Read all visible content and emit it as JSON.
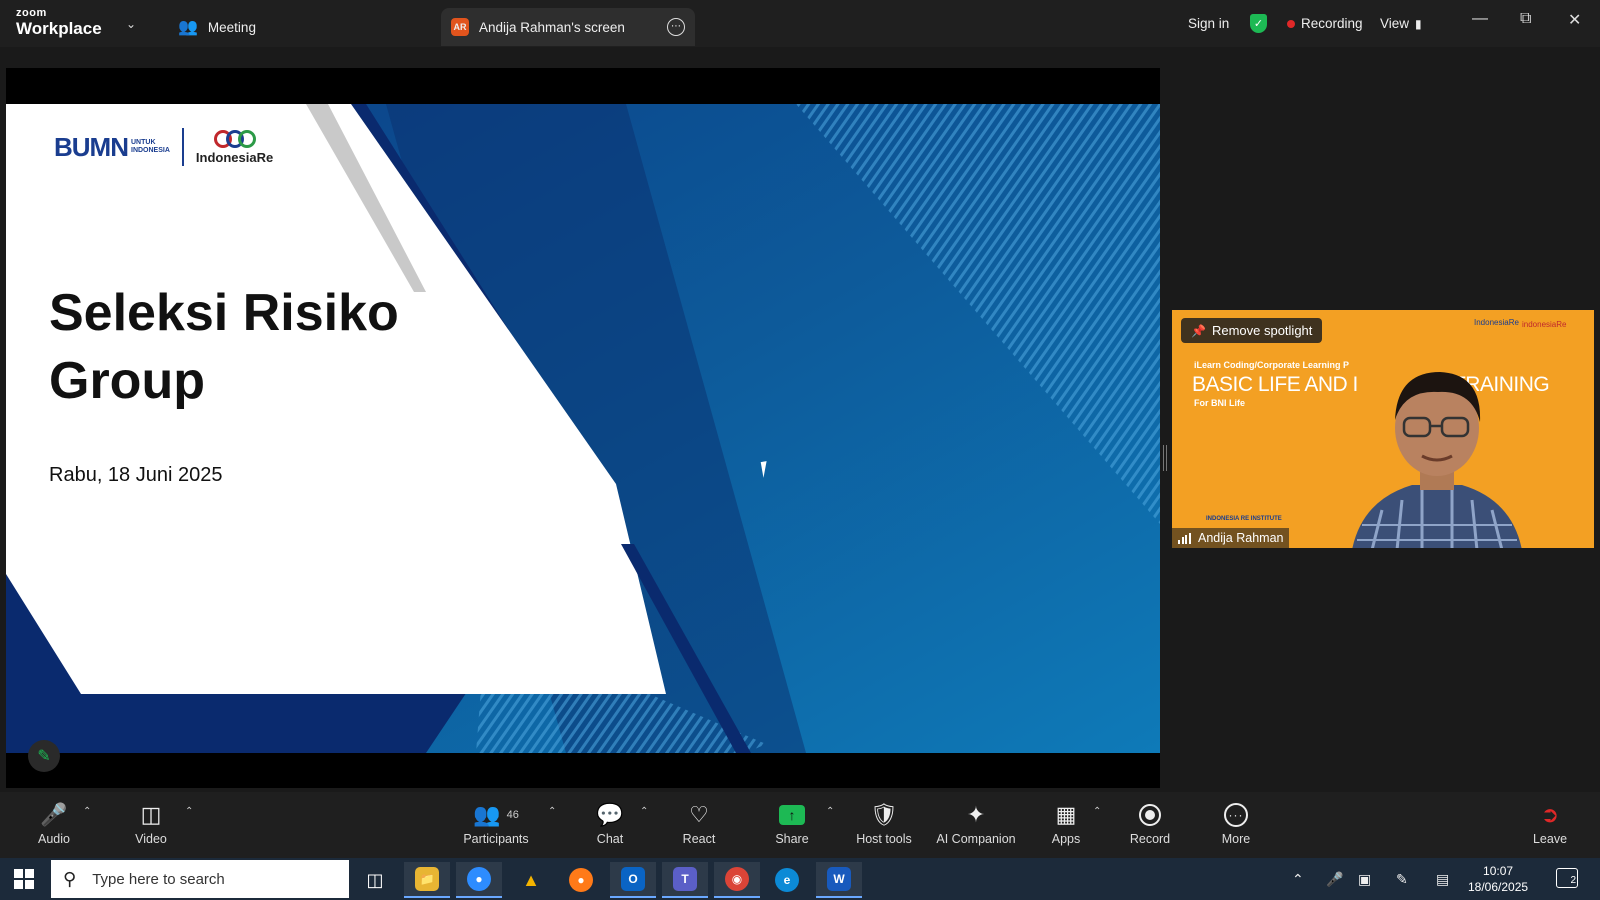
{
  "titlebar": {
    "logo_small": "zoom",
    "logo_big": "Workplace",
    "meeting_tab": "Meeting",
    "screen_tab_avatar": "AR",
    "screen_tab": "Andija Rahman's screen",
    "sign_in": "Sign in",
    "recording": "Recording",
    "view": "View"
  },
  "slide": {
    "logo_bumn": "BUMN",
    "logo_bumn_sub1": "UNTUK",
    "logo_bumn_sub2": "INDONESIA",
    "logo_ire": "IndonesiaRe",
    "title_line1": "Seleksi Risiko",
    "title_line2": "Group",
    "date": "Rabu, 18 Juni 2025"
  },
  "video_tile": {
    "remove_spotlight": "Remove spotlight",
    "participant_name": "Andija Rahman",
    "bg_line1": "iLearn Coding/Corporate Learning P",
    "bg_line2": "BASIC LIFE AND I",
    "bg_line2b": "TRAINING",
    "bg_line3": "For BNI Life",
    "bg_line4": "INDONESIA RE INSTITUTE",
    "bg_logo1": "IndonesiaRe",
    "bg_logo2": "indonesiaRe"
  },
  "toolbar": {
    "audio": "Audio",
    "video": "Video",
    "participants": "Participants",
    "participants_count": "46",
    "chat": "Chat",
    "react": "React",
    "share": "Share",
    "host_tools": "Host tools",
    "ai_companion": "AI Companion",
    "apps": "Apps",
    "record": "Record",
    "more": "More",
    "leave": "Leave"
  },
  "taskbar": {
    "search_placeholder": "Type here to search",
    "time": "10:07",
    "date": "18/06/2025",
    "notification_count": "2"
  },
  "colors": {
    "accent_green": "#1db954",
    "recording_red": "#e02828",
    "slide_blue": "#0d5a9a",
    "tile_orange": "#f3a023"
  }
}
